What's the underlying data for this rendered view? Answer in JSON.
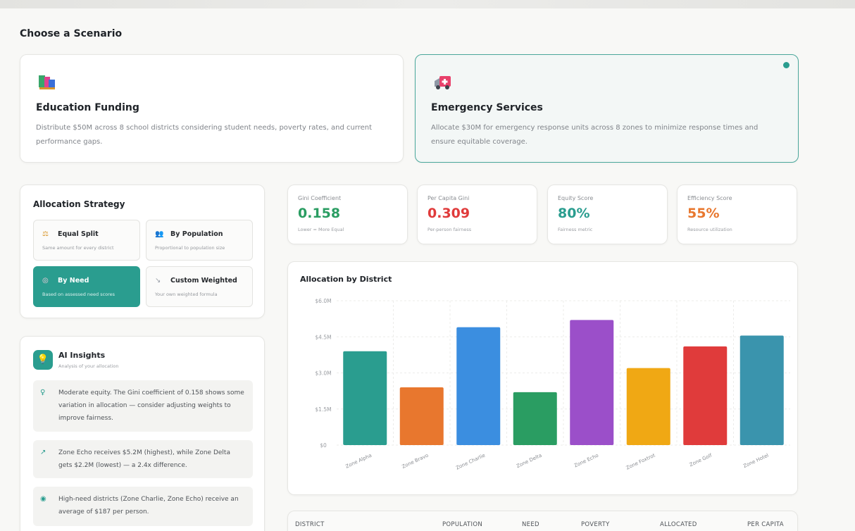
{
  "heading": "Choose a Scenario",
  "scenarios": [
    {
      "title": "Education Funding",
      "description": "Distribute $50M across 8 school districts considering student needs, poverty rates, and current performance gaps.",
      "icon": "books-icon"
    },
    {
      "title": "Emergency Services",
      "description": "Allocate $30M for emergency response units across 8 zones to minimize response times and ensure equitable coverage.",
      "icon": "ambulance-icon",
      "selected": true
    }
  ],
  "strategy": {
    "title": "Allocation Strategy",
    "options": [
      {
        "label": "Equal Split",
        "desc": "Same amount for every district",
        "icon": "scale-icon"
      },
      {
        "label": "By Population",
        "desc": "Proportional to population size",
        "icon": "people-icon"
      },
      {
        "label": "By Need",
        "desc": "Based on assessed need scores",
        "icon": "target-icon",
        "active": true
      },
      {
        "label": "Custom Weighted",
        "desc": "Your own weighted formula",
        "icon": "slider-icon"
      }
    ]
  },
  "insights": {
    "title": "AI Insights",
    "subtitle": "Analysis of your allocation",
    "items": [
      {
        "icon": "lightbulb-icon",
        "text": "Moderate equity. The Gini coefficient of 0.158 shows some variation in allocation — consider adjusting weights to improve fairness."
      },
      {
        "icon": "trend-icon",
        "text": "Zone Echo receives $5.2M (highest), while Zone Delta gets $2.2M (lowest) — a 2.4x difference."
      },
      {
        "icon": "target-icon",
        "text": "High-need districts (Zone Charlie, Zone Echo) receive an average of $187 per person."
      }
    ]
  },
  "metrics": [
    {
      "label": "Gini Coefficient",
      "value": "0.158",
      "sub": "Lower = More Equal",
      "color": "#2a9d62"
    },
    {
      "label": "Per Capita Gini",
      "value": "0.309",
      "sub": "Per-person fairness",
      "color": "#e03b3b"
    },
    {
      "label": "Equity Score",
      "value": "80%",
      "sub": "Fairness metric",
      "color": "#2a9d8f"
    },
    {
      "label": "Efficiency Score",
      "value": "55%",
      "sub": "Resource utilization",
      "color": "#e8772e"
    }
  ],
  "chart": {
    "title": "Allocation by District",
    "y_ticks": [
      "$6.0M",
      "$4.5M",
      "$3.0M",
      "$1.5M",
      "$0"
    ]
  },
  "chart_data": {
    "type": "bar",
    "title": "Allocation by District",
    "categories": [
      "Zone Alpha",
      "Zone Bravo",
      "Zone Charlie",
      "Zone Delta",
      "Zone Echo",
      "Zone Foxtrot",
      "Zone Golf",
      "Zone Hotel"
    ],
    "values": [
      3.9,
      2.4,
      4.9,
      2.2,
      5.2,
      3.2,
      4.1,
      4.55
    ],
    "colors": [
      "#2a9d8f",
      "#e8772e",
      "#3b8ee0",
      "#2a9d62",
      "#9b4fc9",
      "#f0a814",
      "#e03b3b",
      "#3a94ad"
    ],
    "ylim": [
      0,
      6.0
    ],
    "y_unit": "$M",
    "grid": true
  },
  "table": {
    "headers": [
      "DISTRICT",
      "POPULATION",
      "NEED",
      "POVERTY",
      "ALLOCATED",
      "PER CAPITA"
    ]
  }
}
